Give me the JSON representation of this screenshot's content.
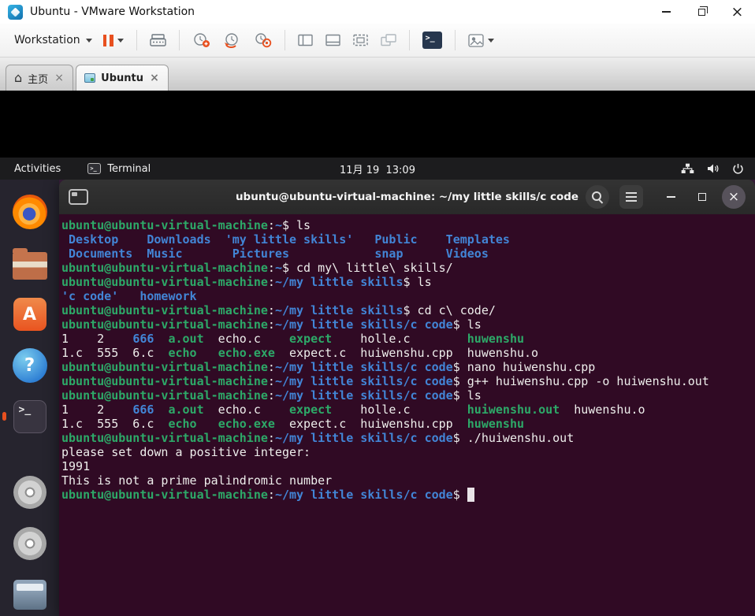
{
  "colors": {
    "term-bg": "#300A24",
    "term-green": "#2DA968",
    "term-blue": "#4285D6",
    "term-white": "#EEEEEC",
    "accent-orange": "#E8501F",
    "topbar-bg": "#1C1C1E",
    "dock-bg": "#26242E"
  },
  "titlebar": {
    "title": "Ubuntu - VMware Workstation"
  },
  "toolbar": {
    "workstation_label": "Workstation"
  },
  "tabs": [
    {
      "label": "主页"
    },
    {
      "label": "Ubuntu"
    }
  ],
  "ubuntu": {
    "topbar": {
      "activities": "Activities",
      "app_name": "Terminal",
      "clock": "11月 19  13:09"
    },
    "dock_items": [
      "firefox",
      "files",
      "ubuntu-software",
      "help",
      "terminal",
      "disc-1",
      "disc-2",
      "drive"
    ],
    "terminal": {
      "title": "ubuntu@ubuntu-virtual-machine: ~/my little skills/c code",
      "lines": [
        [
          {
            "t": "ubuntu@ubuntu-virtual-machine",
            "c": "g"
          },
          {
            "t": ":",
            "c": "w"
          },
          {
            "t": "~",
            "c": "b"
          },
          {
            "t": "$ ls",
            "c": "w"
          }
        ],
        [
          {
            "t": " Desktop    Downloads  'my little skills'   Public    Templates",
            "c": "b"
          }
        ],
        [
          {
            "t": " Documents  Music       Pictures            snap      Videos",
            "c": "b"
          }
        ],
        [
          {
            "t": "ubuntu@ubuntu-virtual-machine",
            "c": "g"
          },
          {
            "t": ":",
            "c": "w"
          },
          {
            "t": "~",
            "c": "b"
          },
          {
            "t": "$ cd my\\ little\\ skills/",
            "c": "w"
          }
        ],
        [
          {
            "t": "ubuntu@ubuntu-virtual-machine",
            "c": "g"
          },
          {
            "t": ":",
            "c": "w"
          },
          {
            "t": "~/my little skills",
            "c": "b"
          },
          {
            "t": "$ ls",
            "c": "w"
          }
        ],
        [
          {
            "t": "'c code'   homework",
            "c": "b"
          }
        ],
        [
          {
            "t": "ubuntu@ubuntu-virtual-machine",
            "c": "g"
          },
          {
            "t": ":",
            "c": "w"
          },
          {
            "t": "~/my little skills",
            "c": "b"
          },
          {
            "t": "$ cd c\\ code/",
            "c": "w"
          }
        ],
        [
          {
            "t": "ubuntu@ubuntu-virtual-machine",
            "c": "g"
          },
          {
            "t": ":",
            "c": "w"
          },
          {
            "t": "~/my little skills/c code",
            "c": "b"
          },
          {
            "t": "$ ls",
            "c": "w"
          }
        ],
        [
          {
            "t": "1    2    ",
            "c": "w"
          },
          {
            "t": "666",
            "c": "b"
          },
          {
            "t": "  ",
            "c": "w"
          },
          {
            "t": "a.out",
            "c": "g"
          },
          {
            "t": "  echo.c    ",
            "c": "w"
          },
          {
            "t": "expect",
            "c": "g"
          },
          {
            "t": "    holle.c        ",
            "c": "w"
          },
          {
            "t": "huwenshu",
            "c": "g"
          }
        ],
        [
          {
            "t": "1.c  555  6.c  ",
            "c": "w"
          },
          {
            "t": "echo",
            "c": "g"
          },
          {
            "t": "   ",
            "c": "w"
          },
          {
            "t": "echo.exe",
            "c": "g"
          },
          {
            "t": "  expect.c  huiwenshu.cpp  huwenshu.o",
            "c": "w"
          }
        ],
        [
          {
            "t": "ubuntu@ubuntu-virtual-machine",
            "c": "g"
          },
          {
            "t": ":",
            "c": "w"
          },
          {
            "t": "~/my little skills/c code",
            "c": "b"
          },
          {
            "t": "$ nano huiwenshu.cpp",
            "c": "w"
          }
        ],
        [
          {
            "t": "ubuntu@ubuntu-virtual-machine",
            "c": "g"
          },
          {
            "t": ":",
            "c": "w"
          },
          {
            "t": "~/my little skills/c code",
            "c": "b"
          },
          {
            "t": "$ g++ huiwenshu.cpp -o huiwenshu.out",
            "c": "w"
          }
        ],
        [
          {
            "t": "ubuntu@ubuntu-virtual-machine",
            "c": "g"
          },
          {
            "t": ":",
            "c": "w"
          },
          {
            "t": "~/my little skills/c code",
            "c": "b"
          },
          {
            "t": "$ ls",
            "c": "w"
          }
        ],
        [
          {
            "t": "1    2    ",
            "c": "w"
          },
          {
            "t": "666",
            "c": "b"
          },
          {
            "t": "  ",
            "c": "w"
          },
          {
            "t": "a.out",
            "c": "g"
          },
          {
            "t": "  echo.c    ",
            "c": "w"
          },
          {
            "t": "expect",
            "c": "g"
          },
          {
            "t": "    holle.c        ",
            "c": "w"
          },
          {
            "t": "huiwenshu.out",
            "c": "g"
          },
          {
            "t": "  huwenshu.o",
            "c": "w"
          }
        ],
        [
          {
            "t": "1.c  555  6.c  ",
            "c": "w"
          },
          {
            "t": "echo",
            "c": "g"
          },
          {
            "t": "   ",
            "c": "w"
          },
          {
            "t": "echo.exe",
            "c": "g"
          },
          {
            "t": "  expect.c  huiwenshu.cpp  ",
            "c": "w"
          },
          {
            "t": "huwenshu",
            "c": "g"
          }
        ],
        [
          {
            "t": "ubuntu@ubuntu-virtual-machine",
            "c": "g"
          },
          {
            "t": ":",
            "c": "w"
          },
          {
            "t": "~/my little skills/c code",
            "c": "b"
          },
          {
            "t": "$ ./huiwenshu.out",
            "c": "w"
          }
        ],
        [
          {
            "t": "please set down a positive integer:",
            "c": "w"
          }
        ],
        [
          {
            "t": "1991",
            "c": "w"
          }
        ],
        [
          {
            "t": "This is not a prime palindromic number",
            "c": "w"
          }
        ],
        [
          {
            "t": "ubuntu@ubuntu-virtual-machine",
            "c": "g"
          },
          {
            "t": ":",
            "c": "w"
          },
          {
            "t": "~/my little skills/c code",
            "c": "b"
          },
          {
            "t": "$ ",
            "c": "w"
          },
          {
            "t": " ",
            "c": "cur"
          }
        ]
      ]
    }
  }
}
